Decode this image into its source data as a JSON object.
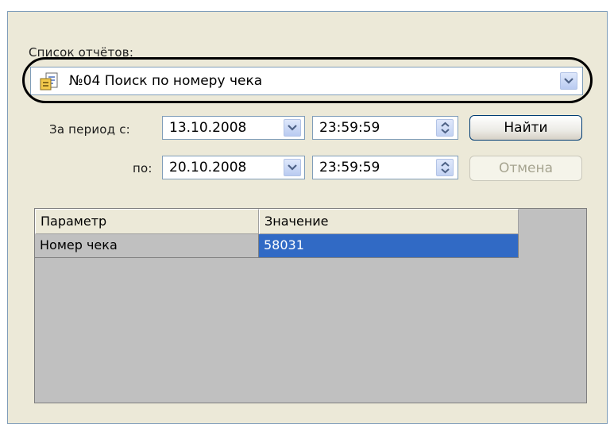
{
  "report": {
    "label": "Список отчётов:",
    "selected": "№04 Поиск по номеру чека"
  },
  "period": {
    "from_label": "За период с:",
    "to_label": "по:",
    "from_date": "13.10.2008",
    "from_time": "23:59:59",
    "to_date": "20.10.2008",
    "to_time": "23:59:59"
  },
  "buttons": {
    "find": "Найти",
    "cancel": "Отмена"
  },
  "grid": {
    "headers": [
      "Параметр",
      "Значение"
    ],
    "rows": [
      {
        "param": "Номер чека",
        "value": "58031"
      }
    ]
  },
  "colors": {
    "selection": "#316ac5",
    "panel": "#ece9d8",
    "grid_bg": "#c0c0c0"
  }
}
